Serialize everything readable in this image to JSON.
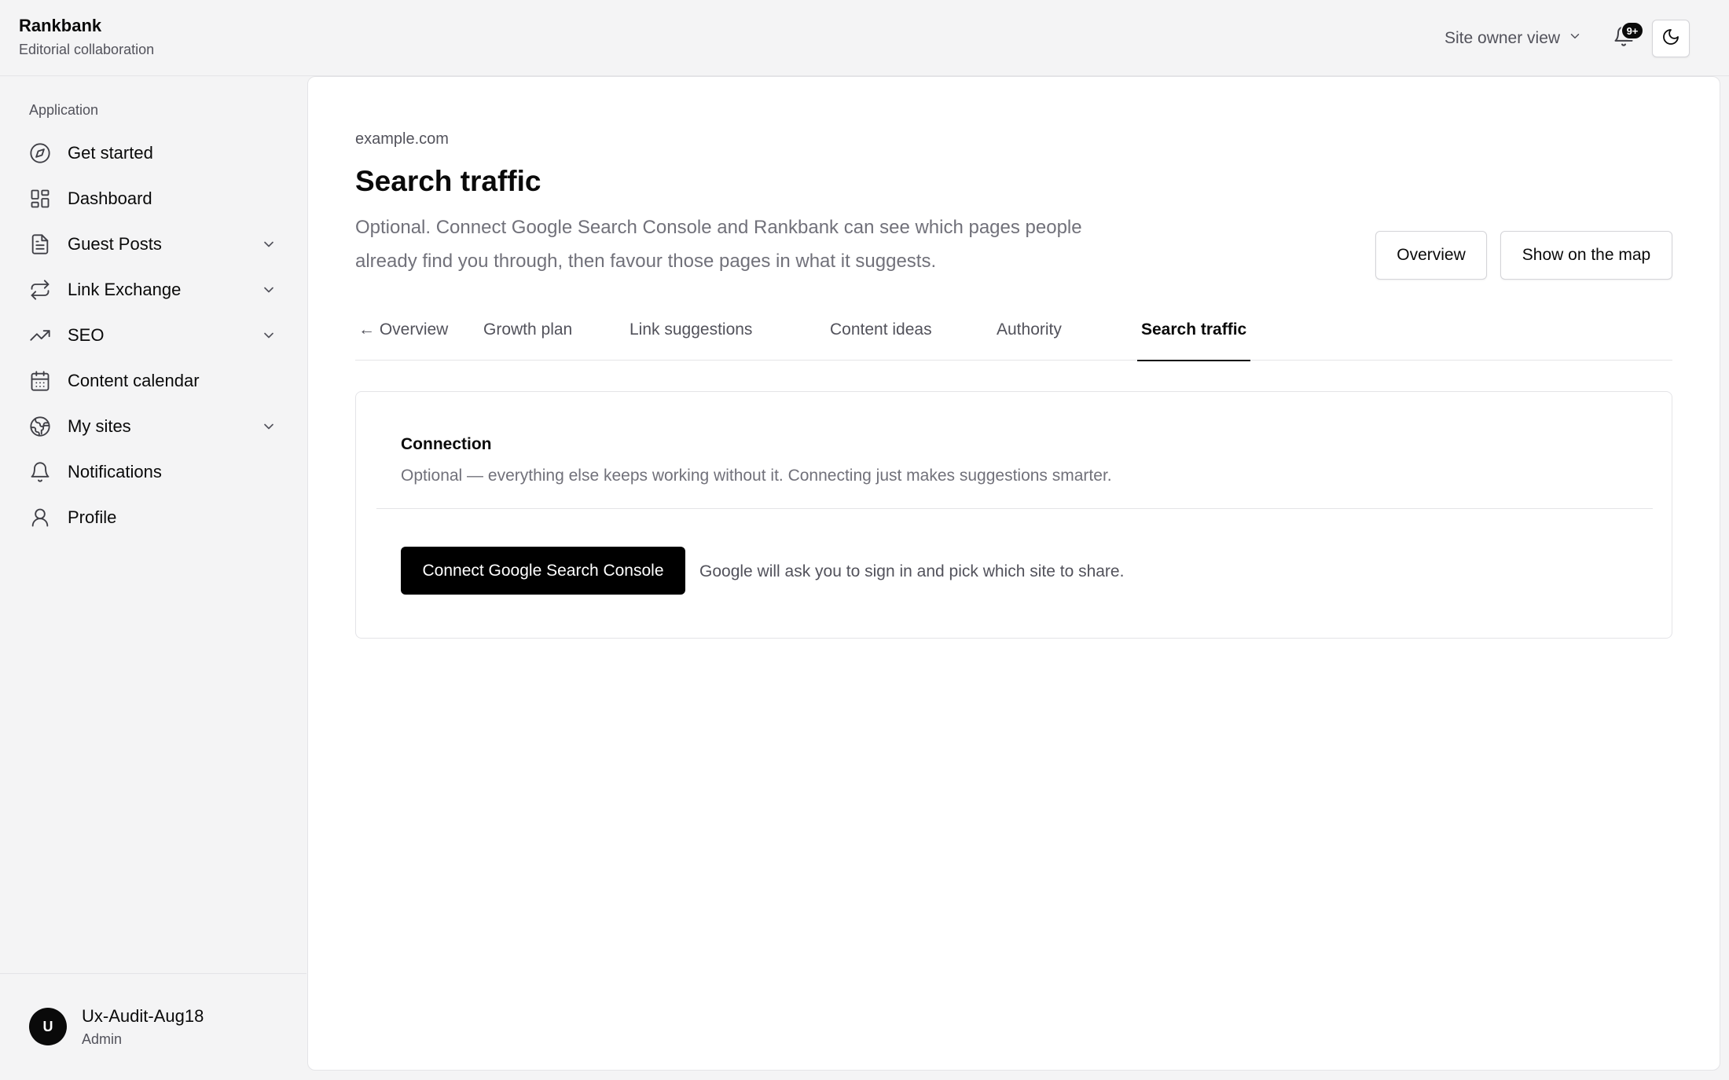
{
  "brand": {
    "name": "Rankbank",
    "subtitle": "Editorial collaboration"
  },
  "header": {
    "view_switch_label": "Site owner view",
    "notifications_badge": "9+"
  },
  "sidebar": {
    "group_label": "Application",
    "items": [
      {
        "label": "Get started",
        "icon": "compass-icon",
        "expandable": false
      },
      {
        "label": "Dashboard",
        "icon": "grid-icon",
        "expandable": false
      },
      {
        "label": "Guest Posts",
        "icon": "document-icon",
        "expandable": true
      },
      {
        "label": "Link Exchange",
        "icon": "repeat-icon",
        "expandable": true
      },
      {
        "label": "SEO",
        "icon": "trending-up-icon",
        "expandable": true
      },
      {
        "label": "Content calendar",
        "icon": "calendar-icon",
        "expandable": false
      },
      {
        "label": "My sites",
        "icon": "globe-icon",
        "expandable": true
      },
      {
        "label": "Notifications",
        "icon": "bell-icon",
        "expandable": false
      },
      {
        "label": "Profile",
        "icon": "user-icon",
        "expandable": false
      }
    ],
    "user": {
      "initial": "U",
      "name": "Ux-Audit-Aug18",
      "role": "Admin"
    }
  },
  "main": {
    "site_domain": "example.com",
    "title": "Search traffic",
    "description": "Optional. Connect Google Search Console and Rankbank can see which pages people already find you through, then favour those pages in what it suggests.",
    "buttons": {
      "overview": "Overview",
      "map": "Show on the map"
    },
    "tabs": [
      {
        "label": "← Overview",
        "active": false
      },
      {
        "label": "Growth plan",
        "active": false
      },
      {
        "label": "Link suggestions",
        "active": false
      },
      {
        "label": "Content ideas",
        "active": false
      },
      {
        "label": "Authority",
        "active": false
      },
      {
        "label": "Search traffic",
        "active": true
      }
    ],
    "connection_card": {
      "title": "Connection",
      "description": "Optional — everything else keeps working without it. Connecting just makes suggestions smarter.",
      "button_label": "Connect Google Search Console",
      "hint": "Google will ask you to sign in and pick which site to share."
    }
  },
  "colors": {
    "accent": "#000000",
    "muted_text": "#71717a",
    "border": "#e4e4e7",
    "background": "#f4f4f5"
  }
}
